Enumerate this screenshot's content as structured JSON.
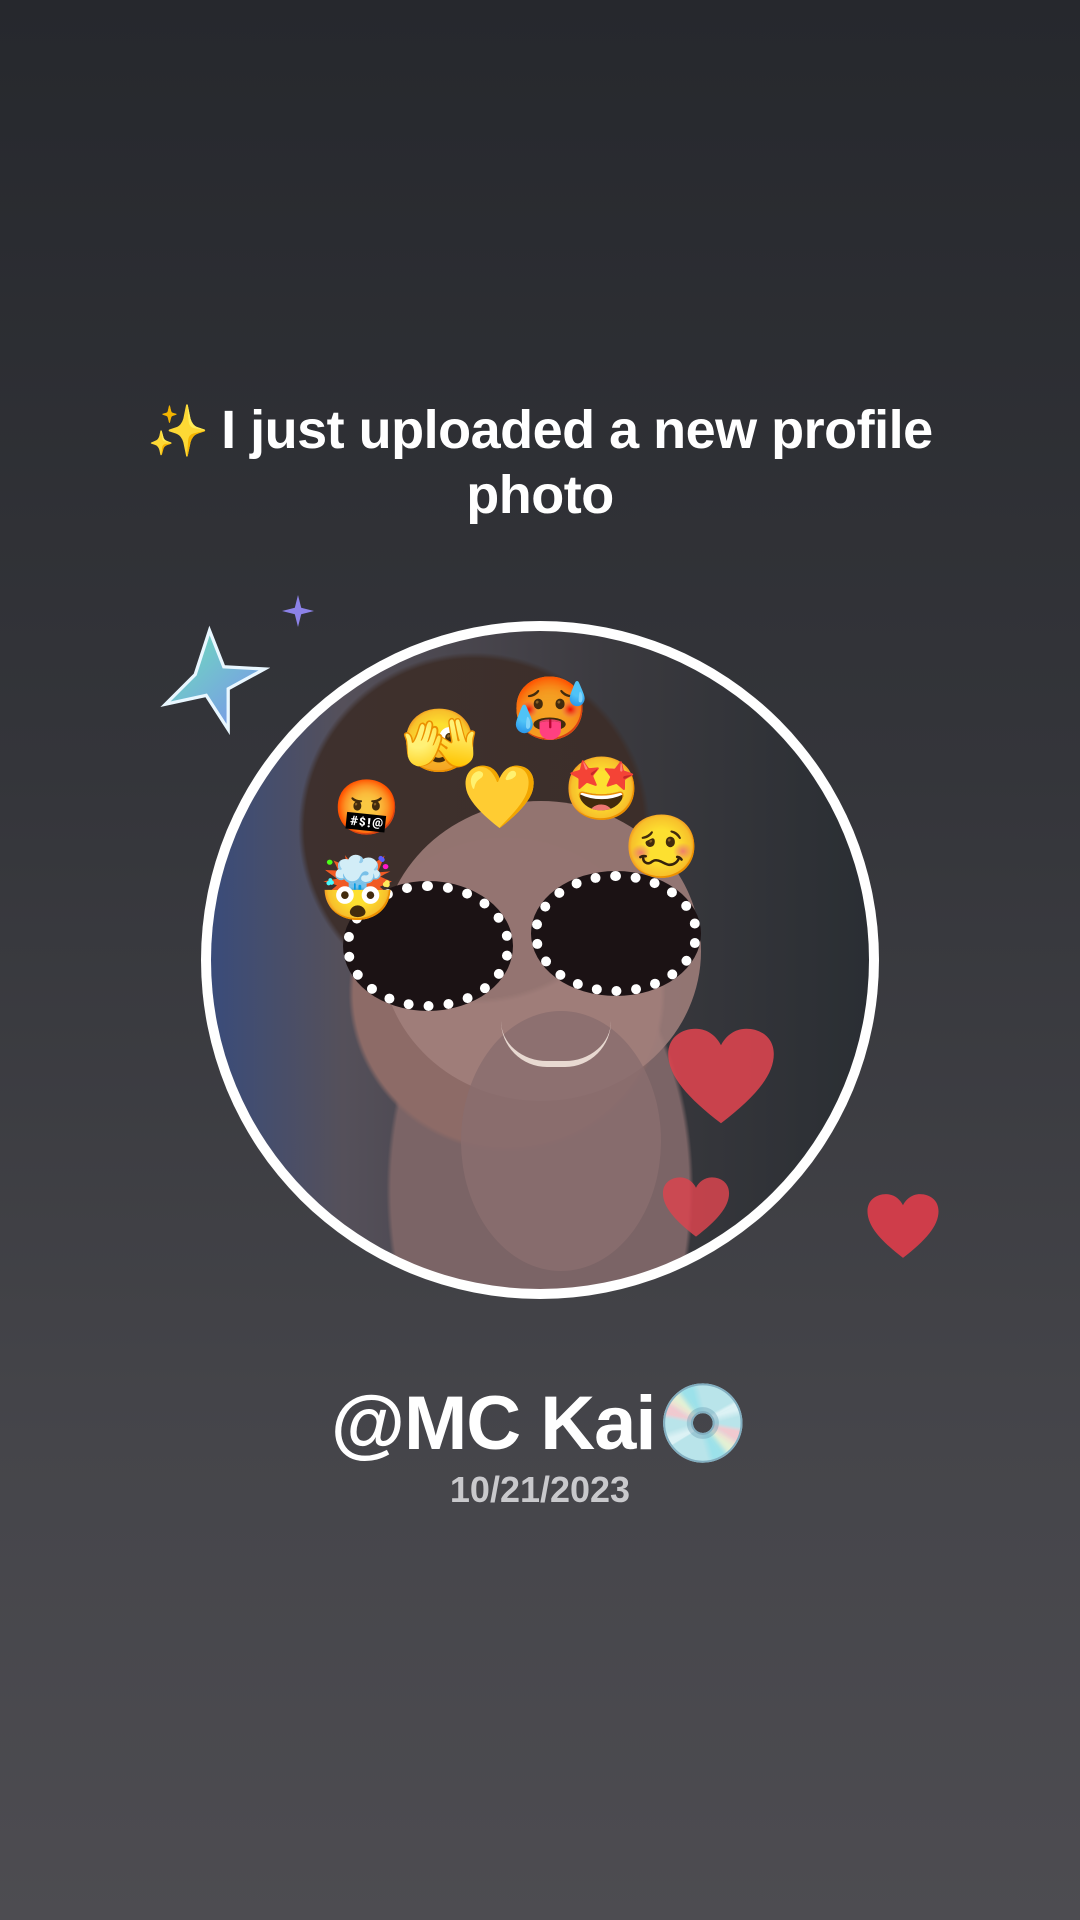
{
  "headline": {
    "sparkle": "✨",
    "text": "I just uploaded a new profile photo"
  },
  "profile": {
    "username": "@MC Kai💿",
    "date": "10/21/2023"
  },
  "decorations": {
    "stars": [
      "star-teal-icon",
      "star-magenta-icon",
      "star-small-purple-icon"
    ],
    "hearts": [
      "heart-icon",
      "heart-icon",
      "heart-icon"
    ],
    "face_emojis": [
      "🫣",
      "🥵",
      "🤬",
      "💛",
      "🤩",
      "🥴",
      "🤯"
    ]
  },
  "colors": {
    "accent_heart": "#d9444f",
    "ring": "#ffffff"
  }
}
